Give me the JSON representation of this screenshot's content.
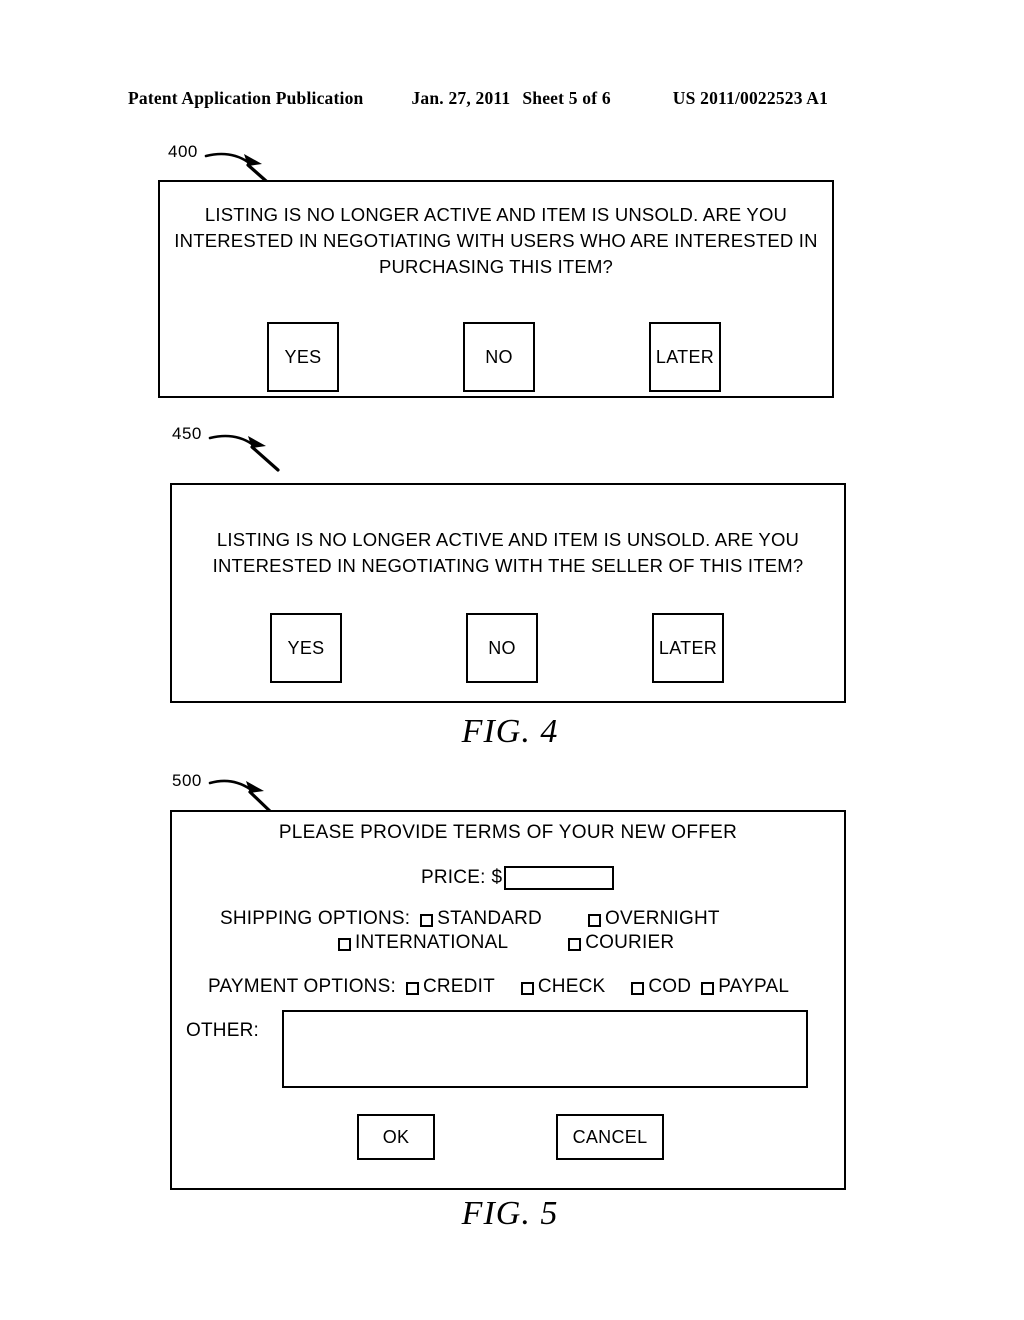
{
  "header": {
    "publication": "Patent Application Publication",
    "date": "Jan. 27, 2011",
    "sheet": "Sheet 5 of 6",
    "patent_number": "US 2011/0022523 A1"
  },
  "figures": [
    {
      "caption": "FIG. 4",
      "dialogs": [
        {
          "ref": "400",
          "prompt": "LISTING IS NO LONGER ACTIVE AND ITEM IS UNSOLD.   ARE YOU\nINTERESTED IN NEGOTIATING WITH  USERS WHO ARE INTERESTED IN\nPURCHASING THIS ITEM?",
          "buttons": [
            {
              "label": "YES"
            },
            {
              "label": "NO"
            },
            {
              "label": "LATER"
            }
          ]
        },
        {
          "ref": "450",
          "prompt": "LISTING IS NO LONGER ACTIVE AND ITEM IS UNSOLD.   ARE YOU\nINTERESTED IN NEGOTIATING WITH THE SELLER OF THIS ITEM?",
          "buttons": [
            {
              "label": "YES"
            },
            {
              "label": "NO"
            },
            {
              "label": "LATER"
            }
          ]
        }
      ]
    },
    {
      "caption": "FIG. 5",
      "dialogs": [
        {
          "ref": "500",
          "title": "PLEASE PROVIDE TERMS OF YOUR NEW OFFER",
          "price": {
            "label": "PRICE:",
            "currency": "$",
            "value": "",
            "placeholder": ""
          },
          "shipping": {
            "label": "SHIPPING OPTIONS:",
            "options": [
              {
                "label": "STANDARD",
                "checked": false
              },
              {
                "label": "OVERNIGHT",
                "checked": false
              },
              {
                "label": "INTERNATIONAL",
                "checked": false
              },
              {
                "label": "COURIER",
                "checked": false
              }
            ]
          },
          "payment": {
            "label": "PAYMENT OPTIONS:",
            "options": [
              {
                "label": "CREDIT",
                "checked": false
              },
              {
                "label": "CHECK",
                "checked": false
              },
              {
                "label": "COD",
                "checked": false
              },
              {
                "label": "PAYPAL",
                "checked": false
              }
            ]
          },
          "other": {
            "label": "OTHER:",
            "value": "",
            "placeholder": ""
          },
          "buttons": [
            {
              "label": "OK"
            },
            {
              "label": "CANCEL"
            }
          ]
        }
      ]
    }
  ],
  "colors": {
    "ink": "#000000",
    "paper": "#ffffff"
  }
}
